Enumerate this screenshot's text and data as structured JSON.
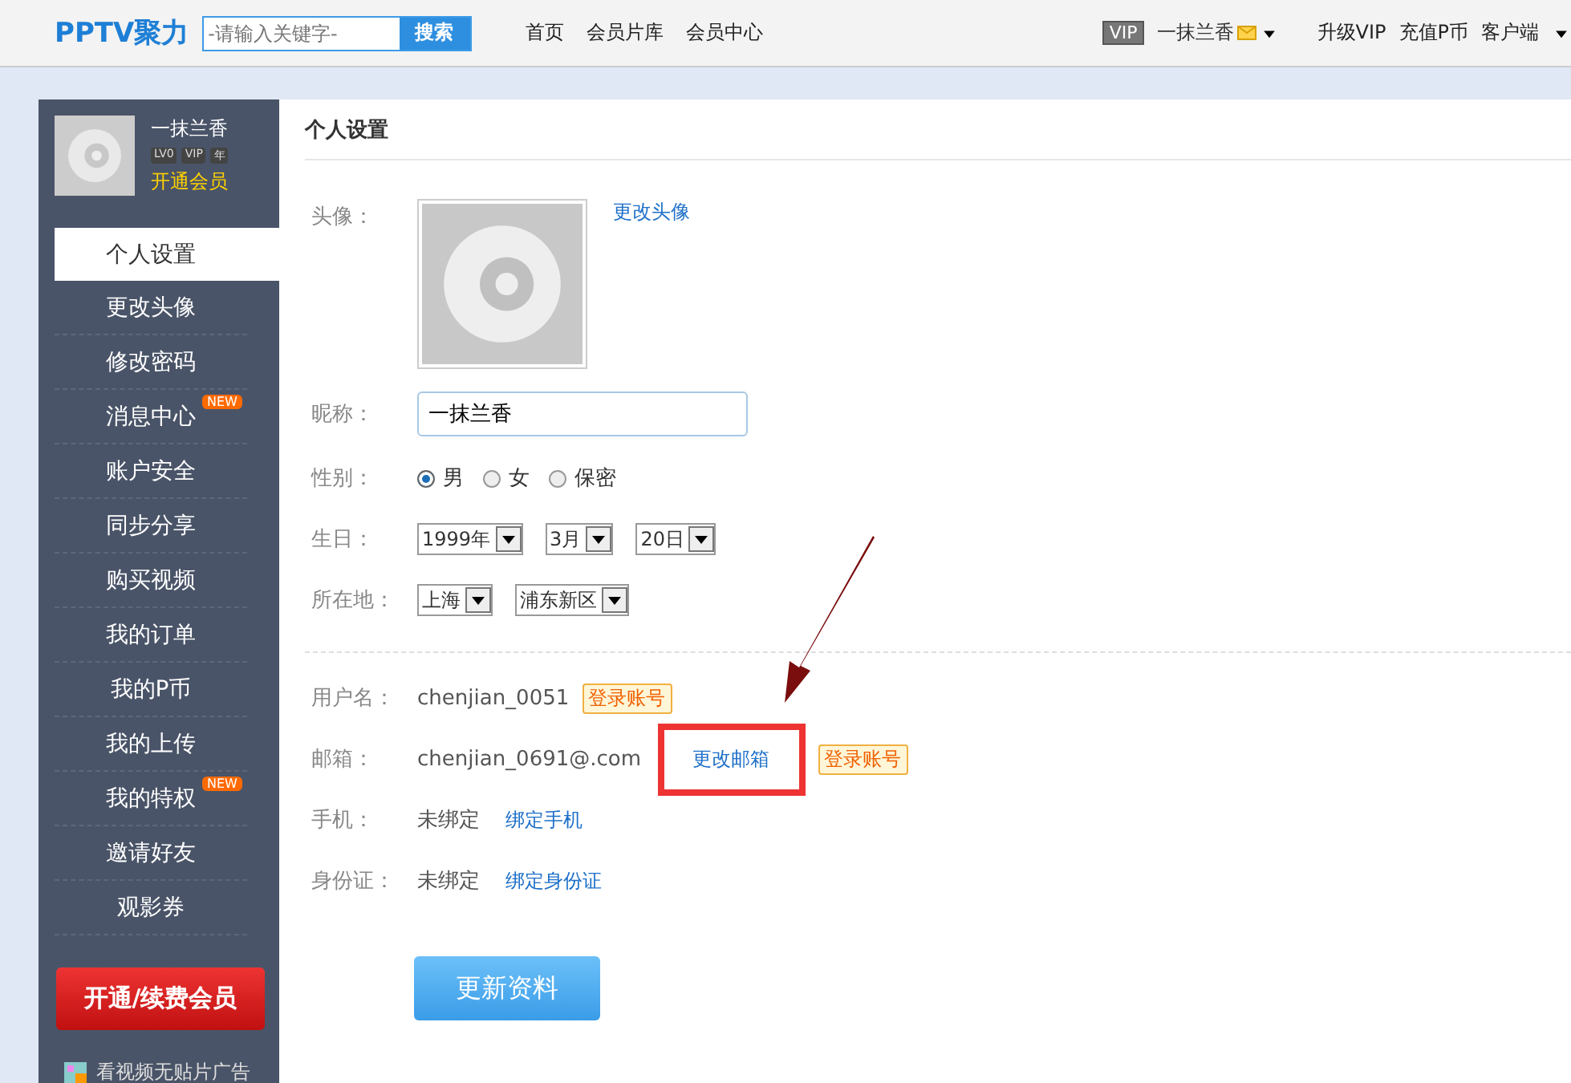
{
  "top_bar": {
    "logo": "PPTV聚力",
    "search": {
      "placeholder": "-请输入关键字-",
      "button": "搜索"
    },
    "nav": [
      "首页",
      "会员片库",
      "会员中心"
    ],
    "vip_badge": "VIP",
    "user": "一抹兰香",
    "links": [
      "升级VIP",
      "充值P币",
      "客户端"
    ]
  },
  "sidebar": {
    "user": {
      "name": "一抹兰香",
      "badges": [
        "LV0",
        "VIP",
        "年"
      ],
      "open_link": "开通会员"
    },
    "items": [
      {
        "label": "个人设置",
        "selected": true
      },
      {
        "label": "更改头像",
        "selected": false
      },
      {
        "label": "修改密码",
        "selected": false
      },
      {
        "label": "消息中心",
        "selected": false,
        "badge": "NEW"
      },
      {
        "label": "账户安全",
        "selected": false
      },
      {
        "label": "同步分享",
        "selected": false
      },
      {
        "label": "购买视频",
        "selected": false
      },
      {
        "label": "我的订单",
        "selected": false
      },
      {
        "label": "我的P币",
        "selected": false
      },
      {
        "label": "我的上传",
        "selected": false
      },
      {
        "label": "我的特权",
        "selected": false,
        "badge": "NEW"
      },
      {
        "label": "邀请好友",
        "selected": false
      },
      {
        "label": "观影券",
        "selected": false
      }
    ],
    "member_button": "开通/续费会员",
    "promo": "看视频无贴片广告"
  },
  "settings": {
    "title": "个人设置",
    "avatar": {
      "label": "头像：",
      "link": "更改头像"
    },
    "nickname": {
      "label": "昵称：",
      "value": "一抹兰香"
    },
    "gender": {
      "label": "性别：",
      "options": [
        {
          "label": "男",
          "selected": true
        },
        {
          "label": "女",
          "selected": false
        },
        {
          "label": "保密",
          "selected": false
        }
      ]
    },
    "birthday": {
      "label": "生日：",
      "selects": [
        "1999年",
        "3月",
        "20日"
      ]
    },
    "location": {
      "label": "所在地：",
      "selects": [
        "上海",
        "浦东新区"
      ]
    },
    "account": [
      {
        "label": "用户名：",
        "value": "chenjian_0051",
        "tag": "登录账号"
      },
      {
        "label": "邮箱：",
        "value": "chenjian_0691@.com",
        "link": "更改邮箱",
        "tag": "登录账号"
      },
      {
        "label": "手机：",
        "value": "未绑定",
        "link": "绑定手机"
      },
      {
        "label": "身份证：",
        "value": "未绑定",
        "link": "绑定身份证"
      }
    ],
    "submit": "更新资料"
  }
}
